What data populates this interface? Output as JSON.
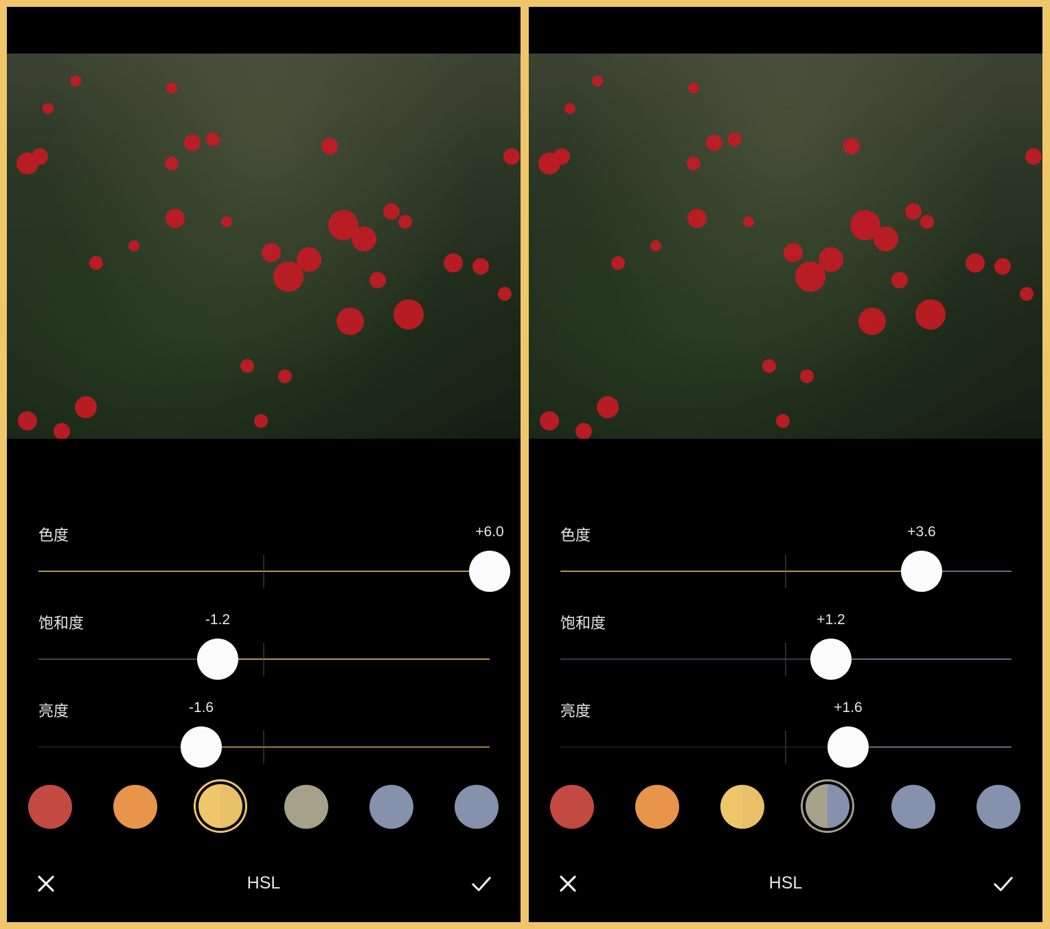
{
  "panels": [
    {
      "sliders": [
        {
          "label": "色度",
          "value_text": "+6.0",
          "value": 6.0
        },
        {
          "label": "饱和度",
          "value_text": "-1.2",
          "value": -1.2
        },
        {
          "label": "亮度",
          "value_text": "-1.6",
          "value": -1.6
        }
      ],
      "swatches": [
        "#c24a42",
        "#e8944a",
        "#efc76a",
        "#a6a28a",
        "#8591ad",
        "#8591ad"
      ],
      "selected_swatch": 2,
      "title": "HSL"
    },
    {
      "sliders": [
        {
          "label": "色度",
          "value_text": "+3.6",
          "value": 3.6
        },
        {
          "label": "饱和度",
          "value_text": "+1.2",
          "value": 1.2
        },
        {
          "label": "亮度",
          "value_text": "+1.6",
          "value": 1.6
        }
      ],
      "swatches": [
        "#c24a42",
        "#e8944a",
        "#efc76a",
        "#a6a28a",
        "#8591ad",
        "#8591ad"
      ],
      "selected_swatch": 3,
      "title": "HSL"
    }
  ],
  "slider_range": [
    -10,
    10
  ],
  "colors": {
    "frame": "#efc76a",
    "yellow": "#efc76a",
    "blue": "#8591ad",
    "background": "#000000"
  },
  "icons": {
    "cancel": "close-icon",
    "confirm": "checkmark-icon"
  }
}
